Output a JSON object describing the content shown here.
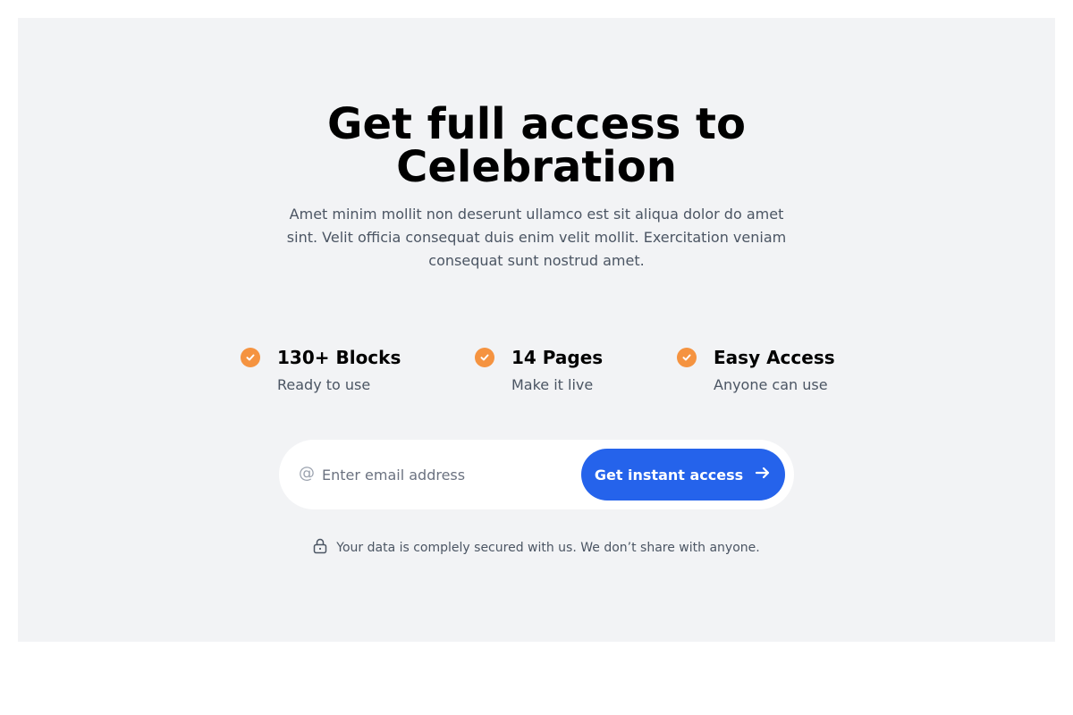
{
  "hero": {
    "title_line1": "Get full access to",
    "title_line2": "Celebration",
    "subtitle": "Amet minim mollit non deserunt ullamco est sit aliqua dolor do amet sint. Velit officia consequat duis enim velit mollit. Exercitation veniam consequat sunt nostrud amet."
  },
  "features": [
    {
      "title": "130+ Blocks",
      "subtitle": "Ready to use",
      "icon": "check-circle-icon"
    },
    {
      "title": "14 Pages",
      "subtitle": "Make it live",
      "icon": "check-circle-icon"
    },
    {
      "title": "Easy Access",
      "subtitle": "Anyone can use",
      "icon": "check-circle-icon"
    }
  ],
  "form": {
    "email_placeholder": "Enter email address",
    "email_value": "",
    "at_icon": "@",
    "cta_label": "Get instant access"
  },
  "security_note": "Your data is complely secured with us. We don’t share with anyone.",
  "colors": {
    "background": "#f2f3f5",
    "accent_check": "#f59340",
    "button": "#2563eb"
  }
}
